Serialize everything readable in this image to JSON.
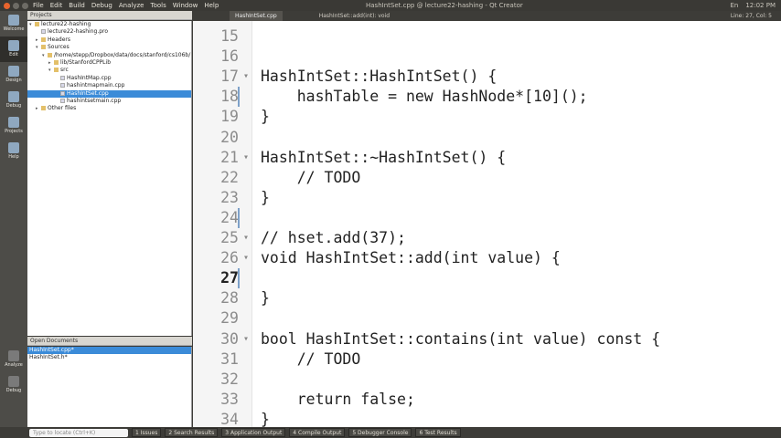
{
  "menubar": {
    "items": [
      "File",
      "Edit",
      "Build",
      "Debug",
      "Analyze",
      "Tools",
      "Window",
      "Help"
    ],
    "title": "HashIntSet.cpp @ lecture22-hashing - Qt Creator",
    "tray": [
      "En",
      "12:02 PM"
    ]
  },
  "modebar": {
    "modes": [
      "Welcome",
      "Edit",
      "Design",
      "Debug",
      "Projects",
      "Help"
    ],
    "bottom": [
      "Analyze",
      "Debug"
    ]
  },
  "projects": {
    "header": "Projects",
    "rows": [
      {
        "label": "lecture22-hashing",
        "indent": 0,
        "arrow": "▾",
        "type": "folder"
      },
      {
        "label": "lecture22-hashing.pro",
        "indent": 1,
        "arrow": "",
        "type": "file"
      },
      {
        "label": "Headers",
        "indent": 1,
        "arrow": "▸",
        "type": "folder"
      },
      {
        "label": "Sources",
        "indent": 1,
        "arrow": "▾",
        "type": "folder"
      },
      {
        "label": "/home/stepp/Dropbox/data/docs/stanford/cs106b/18",
        "indent": 2,
        "arrow": "▾",
        "type": "folder"
      },
      {
        "label": "lib/StanfordCPPLib",
        "indent": 3,
        "arrow": "▸",
        "type": "folder"
      },
      {
        "label": "src",
        "indent": 3,
        "arrow": "▾",
        "type": "folder"
      },
      {
        "label": "HashIntMap.cpp",
        "indent": 4,
        "arrow": "",
        "type": "file"
      },
      {
        "label": "hashintmapmain.cpp",
        "indent": 4,
        "arrow": "",
        "type": "file"
      },
      {
        "label": "HashIntSet.cpp",
        "indent": 4,
        "arrow": "",
        "type": "file",
        "selected": true
      },
      {
        "label": "hashintsetmain.cpp",
        "indent": 4,
        "arrow": "",
        "type": "file"
      },
      {
        "label": "Other files",
        "indent": 1,
        "arrow": "▸",
        "type": "folder"
      }
    ]
  },
  "opendocs": {
    "header": "Open Documents",
    "rows": [
      {
        "label": "HashIntSet.cpp*",
        "selected": true
      },
      {
        "label": "HashIntSet.h*",
        "selected": false
      }
    ]
  },
  "editor_toolbar": {
    "tab": "HashIntSet.cpp",
    "function": "HashIntSet::add(int): void",
    "position": "Line: 27, Col: 5"
  },
  "code": [
    {
      "n": "15",
      "text": ""
    },
    {
      "n": "16",
      "text": ""
    },
    {
      "n": "17",
      "text": "HashIntSet::HashIntSet() {",
      "fold": "▾"
    },
    {
      "n": "18",
      "text": "    hashTable = new HashNode*[10]();",
      "mark": true
    },
    {
      "n": "19",
      "text": "}"
    },
    {
      "n": "20",
      "text": ""
    },
    {
      "n": "21",
      "text": "HashIntSet::~HashIntSet() {",
      "fold": "▾"
    },
    {
      "n": "22",
      "text": "    // TODO"
    },
    {
      "n": "23",
      "text": "}"
    },
    {
      "n": "24",
      "text": "",
      "mark": true
    },
    {
      "n": "25",
      "text": "// hset.add(37);",
      "fold": "▾"
    },
    {
      "n": "26",
      "text": "void HashIntSet::add(int value) {",
      "fold": "▾"
    },
    {
      "n": "27",
      "text": "",
      "current": true,
      "mark": true
    },
    {
      "n": "28",
      "text": "}"
    },
    {
      "n": "29",
      "text": ""
    },
    {
      "n": "30",
      "text": "bool HashIntSet::contains(int value) const {",
      "fold": "▾"
    },
    {
      "n": "31",
      "text": "    // TODO"
    },
    {
      "n": "32",
      "text": ""
    },
    {
      "n": "33",
      "text": "    return false;"
    },
    {
      "n": "34",
      "text": "}"
    }
  ],
  "outputbar": {
    "locator_placeholder": "Type to locate (Ctrl+K)",
    "buttons": [
      "1 Issues",
      "2 Search Results",
      "3 Application Output",
      "4 Compile Output",
      "5 Debugger Console",
      "6 Test Results"
    ]
  }
}
